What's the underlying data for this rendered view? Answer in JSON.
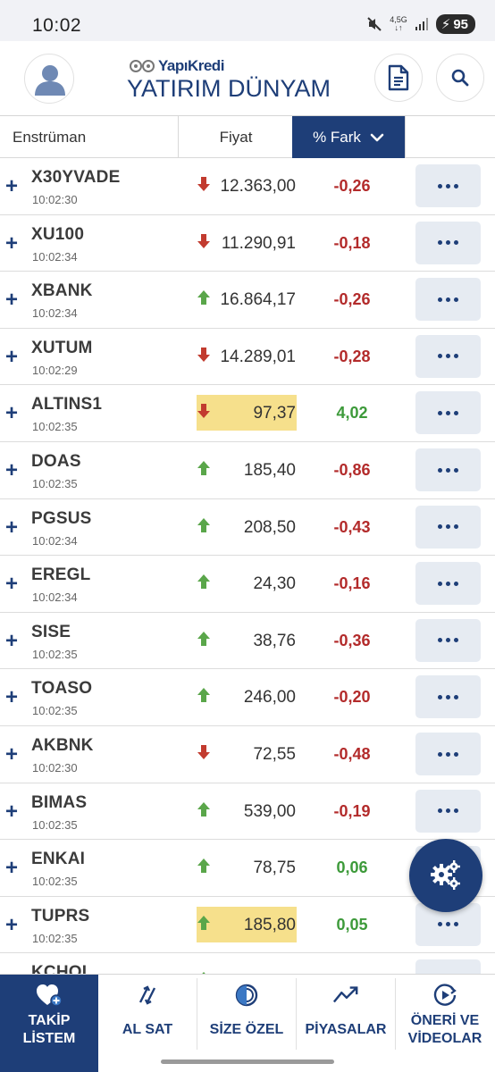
{
  "status_bar": {
    "time": "10:02",
    "network": "4,5G",
    "battery": "95"
  },
  "header": {
    "brand": "YapıKredi",
    "product": "YATIRIM DÜNYAM",
    "icons": [
      "user-icon",
      "document-icon",
      "search-icon"
    ]
  },
  "columns": {
    "instrument": "Enstrüman",
    "price": "Fiyat",
    "change": "% Fark"
  },
  "colors": {
    "brand": "#1e3e78",
    "down": "#b32b2b",
    "up": "#3d9a3a",
    "highlight": "#f6e08c"
  },
  "rows": [
    {
      "symbol": "X30YVADE",
      "time": "10:02:30",
      "price": "12.363,00",
      "change": "-0,26",
      "direction": "down",
      "change_sign": "neg",
      "highlight": false
    },
    {
      "symbol": "XU100",
      "time": "10:02:34",
      "price": "11.290,91",
      "change": "-0,18",
      "direction": "down",
      "change_sign": "neg",
      "highlight": false
    },
    {
      "symbol": "XBANK",
      "time": "10:02:34",
      "price": "16.864,17",
      "change": "-0,26",
      "direction": "up",
      "change_sign": "neg",
      "highlight": false
    },
    {
      "symbol": "XUTUM",
      "time": "10:02:29",
      "price": "14.289,01",
      "change": "-0,28",
      "direction": "down",
      "change_sign": "neg",
      "highlight": false
    },
    {
      "symbol": "ALTINS1",
      "time": "10:02:35",
      "price": "97,37",
      "change": "4,02",
      "direction": "down",
      "change_sign": "pos",
      "highlight": true
    },
    {
      "symbol": "DOAS",
      "time": "10:02:35",
      "price": "185,40",
      "change": "-0,86",
      "direction": "up",
      "change_sign": "neg",
      "highlight": false
    },
    {
      "symbol": "PGSUS",
      "time": "10:02:34",
      "price": "208,50",
      "change": "-0,43",
      "direction": "up",
      "change_sign": "neg",
      "highlight": false
    },
    {
      "symbol": "EREGL",
      "time": "10:02:34",
      "price": "24,30",
      "change": "-0,16",
      "direction": "up",
      "change_sign": "neg",
      "highlight": false
    },
    {
      "symbol": "SISE",
      "time": "10:02:35",
      "price": "38,76",
      "change": "-0,36",
      "direction": "up",
      "change_sign": "neg",
      "highlight": false
    },
    {
      "symbol": "TOASO",
      "time": "10:02:35",
      "price": "246,00",
      "change": "-0,20",
      "direction": "up",
      "change_sign": "neg",
      "highlight": false
    },
    {
      "symbol": "AKBNK",
      "time": "10:02:30",
      "price": "72,55",
      "change": "-0,48",
      "direction": "down",
      "change_sign": "neg",
      "highlight": false
    },
    {
      "symbol": "BIMAS",
      "time": "10:02:35",
      "price": "539,00",
      "change": "-0,19",
      "direction": "up",
      "change_sign": "neg",
      "highlight": false
    },
    {
      "symbol": "ENKAI",
      "time": "10:02:35",
      "price": "78,75",
      "change": "0,06",
      "direction": "up",
      "change_sign": "pos",
      "highlight": false
    },
    {
      "symbol": "TUPRS",
      "time": "10:02:35",
      "price": "185,80",
      "change": "0,05",
      "direction": "up",
      "change_sign": "pos",
      "highlight": true
    },
    {
      "symbol": "KCHOL",
      "time": "",
      "price": "",
      "change": "",
      "direction": "up",
      "change_sign": "pos",
      "highlight": false
    }
  ],
  "nav": [
    {
      "id": "takip",
      "label": "TAKİP LİSTEM",
      "icon": "heart-plus-icon",
      "active": true
    },
    {
      "id": "alsat",
      "label": "AL SAT",
      "icon": "arrows-icon",
      "active": false
    },
    {
      "id": "size",
      "label": "SİZE ÖZEL",
      "icon": "globe-icon",
      "active": false
    },
    {
      "id": "piyasalar",
      "label": "PİYASALAR",
      "icon": "trend-icon",
      "active": false
    },
    {
      "id": "oneri",
      "label": "ÖNERİ VE VİDEOLAR",
      "icon": "play-icon",
      "active": false
    }
  ]
}
